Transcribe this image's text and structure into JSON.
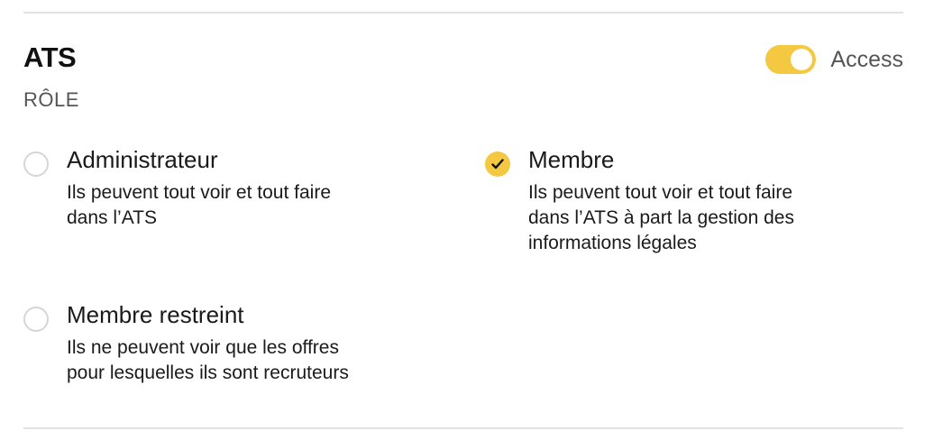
{
  "section": {
    "title": "ATS",
    "subtitle": "RÔLE"
  },
  "access": {
    "label": "Access",
    "enabled": true,
    "accent_color": "#f5c842"
  },
  "roles": [
    {
      "label": "Administrateur",
      "description": "Ils peuvent tout voir et tout faire\ndans l’ATS",
      "selected": false
    },
    {
      "label": "Membre",
      "description": "Ils peuvent tout voir et tout faire\ndans l’ATS à part la gestion des\ninformations légales",
      "selected": true
    },
    {
      "label": "Membre restreint",
      "description": "Ils ne peuvent voir que les offres\npour lesquelles ils sont recruteurs",
      "selected": false
    }
  ]
}
